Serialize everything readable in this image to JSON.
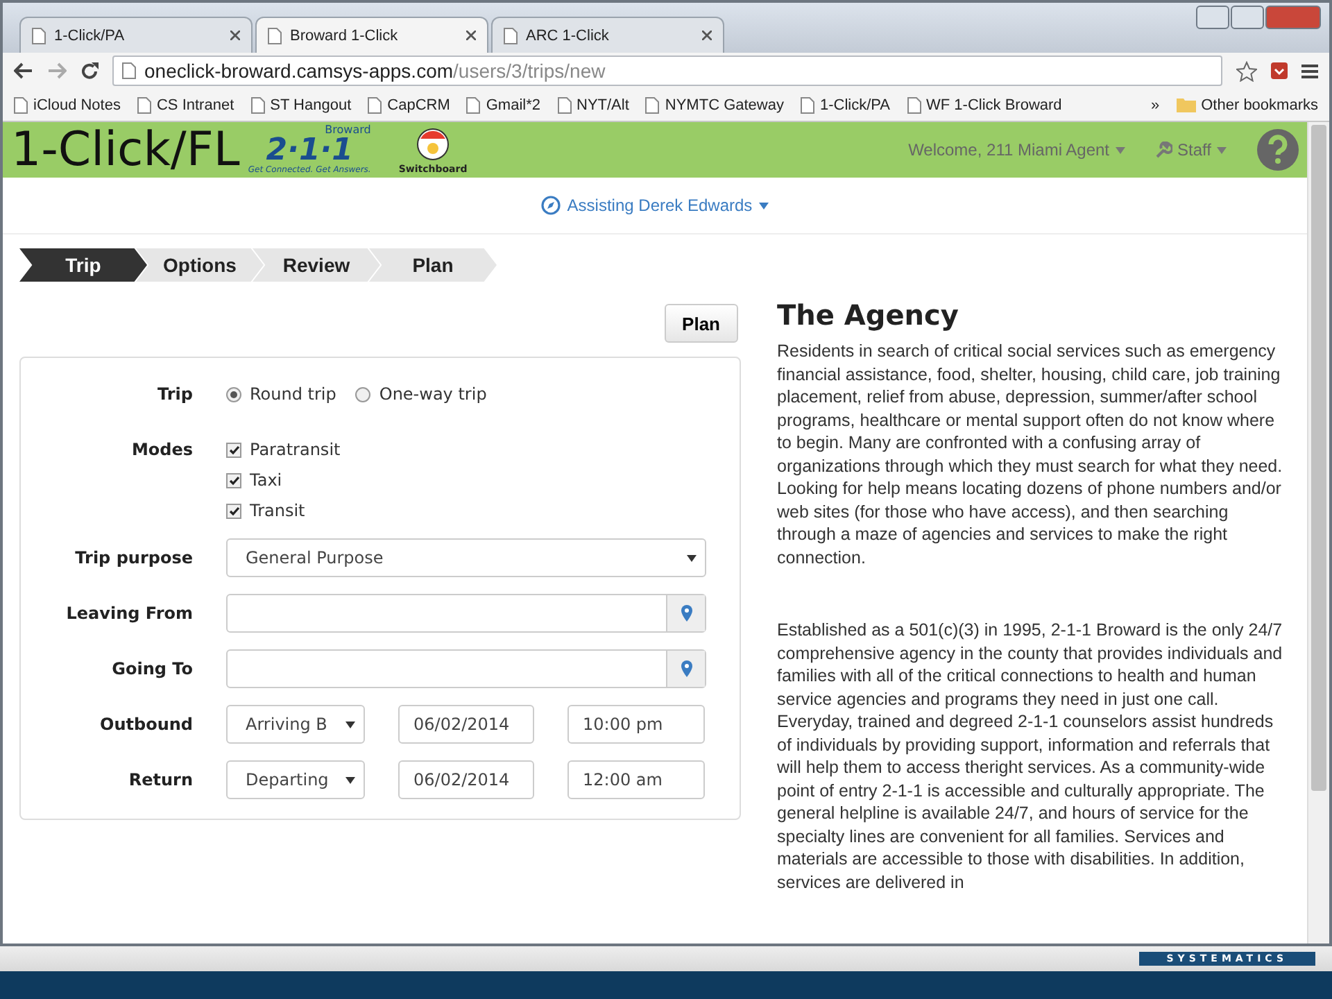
{
  "browser": {
    "tabs": [
      {
        "title": "1-Click/PA",
        "selected": false
      },
      {
        "title": "Broward 1-Click",
        "selected": true
      },
      {
        "title": "ARC 1-Click",
        "selected": false
      }
    ],
    "url": {
      "host": "oneclick-broward.camsys-apps.com",
      "path": "/users/3/trips/new"
    },
    "bookmarks": [
      "iCloud Notes",
      "CS Intranet",
      "ST Hangout",
      "CapCRM",
      "Gmail*2",
      "NYT/Alt",
      "NYMTC Gateway",
      "1-Click/PA",
      "WF 1-Click Broward"
    ],
    "more": "»",
    "other_bookmarks": "Other bookmarks"
  },
  "header": {
    "brand": "1-Click/FL",
    "logo_top": "Broward",
    "logo_main": "2·1·1",
    "logo_tagline": "Get Connected. Get Answers.",
    "switchboard": "Switchboard",
    "welcome": "Welcome, 211 Miami Agent",
    "staff": "Staff"
  },
  "assisting": "Assisting Derek Edwards",
  "steps": [
    {
      "label": "Trip",
      "selected": true
    },
    {
      "label": "Options",
      "selected": false
    },
    {
      "label": "Review",
      "selected": false
    },
    {
      "label": "Plan",
      "selected": false
    }
  ],
  "plan_button": "Plan",
  "form": {
    "rows": [
      {
        "kind": "radio",
        "label": "Trip",
        "options": [
          {
            "label": "Round trip",
            "selected": true
          },
          {
            "label": "One-way trip",
            "selected": false
          }
        ]
      },
      {
        "kind": "checks",
        "label": "Modes",
        "options": [
          {
            "label": "Paratransit",
            "checked": true
          },
          {
            "label": "Taxi",
            "checked": true
          },
          {
            "label": "Transit",
            "checked": true
          }
        ]
      },
      {
        "kind": "select",
        "label": "Trip purpose",
        "value": "General Purpose"
      },
      {
        "kind": "location",
        "label": "Leaving From"
      },
      {
        "kind": "location",
        "label": "Going To"
      },
      {
        "kind": "datetime",
        "label": "Outbound",
        "mode": "Arriving B",
        "date": "06/02/2014",
        "time": "10:00 pm"
      },
      {
        "kind": "datetime",
        "label": "Return",
        "mode": "Departing",
        "date": "06/02/2014",
        "time": "12:00 am"
      }
    ]
  },
  "agency": {
    "title": "The Agency",
    "paragraphs": [
      "Residents in search of critical social services such as emergency financial assistance, food, shelter, housing, child care, job training placement, relief from abuse, depression, summer/after school programs, healthcare or mental support often do not know where to begin. Many are confronted with a confusing array of organizations through which they must search for what they need. Looking for help means locating dozens of phone numbers and/or web sites (for those who have access), and then searching through a maze of agencies and services to make the right connection.",
      "Established as a 501(c)(3) in 1995, 2-1-1 Broward is the only 24/7 comprehensive agency in the county that provides individuals and families with all of the critical connections to health and human service agencies and programs they need in just one call. Everyday, trained and degreed 2-1-1 counselors assist hundreds of individuals by providing support, information and referrals that will help them to access theright services. As a community-wide point of entry 2-1-1 is accessible and culturally appropriate. The general helpline is available 24/7, and hours of service for the specialty lines are convenient for all families. Services and materials are accessible to those with disabilities. In addition, services are delivered in"
    ]
  },
  "footer": {
    "logo": "SYSTEMATICS"
  }
}
